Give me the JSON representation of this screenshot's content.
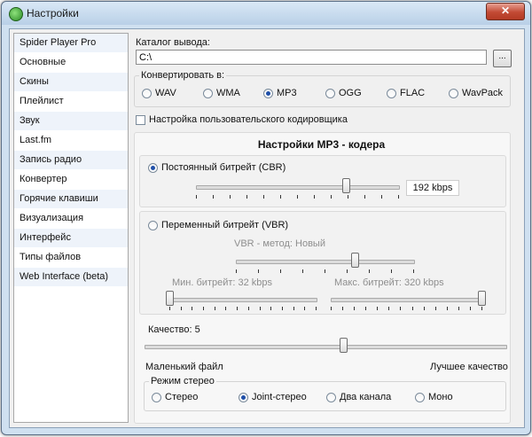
{
  "window": {
    "title": "Настройки",
    "close_label": "✕"
  },
  "sidebar": {
    "items": [
      {
        "label": "Spider Player Pro"
      },
      {
        "label": "Основные"
      },
      {
        "label": "Скины"
      },
      {
        "label": "Плейлист"
      },
      {
        "label": "Звук"
      },
      {
        "label": "Last.fm"
      },
      {
        "label": "Запись радио"
      },
      {
        "label": "Конвертер"
      },
      {
        "label": "Горячие клавиши"
      },
      {
        "label": "Визуализация"
      },
      {
        "label": "Интерфейс"
      },
      {
        "label": "Типы файлов"
      },
      {
        "label": "Web Interface (beta)"
      }
    ]
  },
  "output": {
    "label": "Каталог вывода:",
    "path": "C:\\",
    "browse_label": "..."
  },
  "convert": {
    "legend": "Конвертировать в:",
    "formats": [
      "WAV",
      "WMA",
      "MP3",
      "OGG",
      "FLAC",
      "WavPack"
    ],
    "selected": "MP3"
  },
  "custom_encoder": {
    "label": "Настройка пользовательского кодировщика",
    "checked": false
  },
  "mp3": {
    "title": "Настройки MP3 - кодера",
    "cbr": {
      "label": "Постоянный битрейт (CBR)",
      "selected": true,
      "value": "192 kbps",
      "position": 0.74
    },
    "vbr": {
      "label": "Переменный битрейт (VBR)",
      "selected": false,
      "method_label": "VBR - метод: Новый",
      "method_position": 0.67,
      "min_label": "Мин. битрейт: 32 kbps",
      "min_position": 0.0,
      "max_label": "Макс. битрейт: 320 kbps",
      "max_position": 1.0
    },
    "quality": {
      "label": "Качество: 5",
      "position": 0.55,
      "left_label": "Маленький файл",
      "right_label": "Лучшее качество"
    },
    "stereo": {
      "legend": "Режим стерео",
      "options": [
        "Стерео",
        "Joint-стерео",
        "Два канала",
        "Моно"
      ],
      "selected": "Joint-стерео"
    }
  }
}
